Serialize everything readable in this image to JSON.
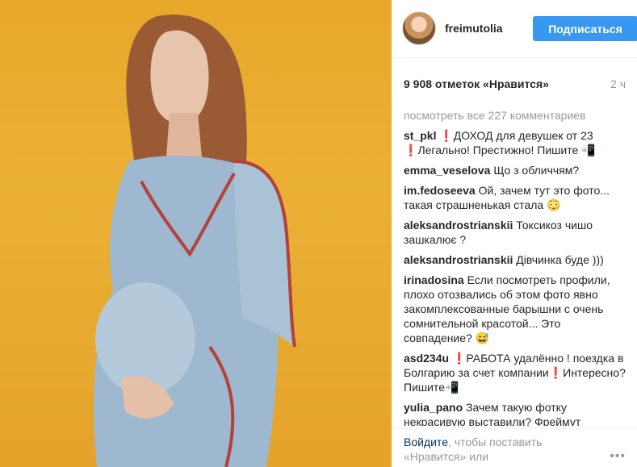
{
  "post": {
    "username": "freimutolia",
    "follow_label": "Подписаться",
    "likes_text": "9 908 отметок «Нравится»",
    "time_ago": "2 ч",
    "view_all_comments": "посмотреть все 227 комментариев",
    "comments": [
      {
        "user": "st_pkl",
        "parts": [
          {
            "t": "❗",
            "c": "excl"
          },
          {
            "t": "ДОХОД для девушек от 23 "
          },
          {
            "t": "❗",
            "c": "excl"
          },
          {
            "t": "Легально! Престижно! Пишите 📲"
          }
        ]
      },
      {
        "user": "emma_veselova",
        "parts": [
          {
            "t": "Що з обличчям?"
          }
        ]
      },
      {
        "user": "im.fedoseeva",
        "parts": [
          {
            "t": "Ой, зачем тут это фото... такая страшненькая стала 😳"
          }
        ]
      },
      {
        "user": "aleksandrostrianskii",
        "parts": [
          {
            "t": "Токсикоз чишо зашкалює ?"
          }
        ]
      },
      {
        "user": "aleksandrostrianskii",
        "parts": [
          {
            "t": "Дівчинка буде )))"
          }
        ]
      },
      {
        "user": "irinadosina",
        "parts": [
          {
            "t": "Если посмотреть профили, плохо отозвались об этом фото явно закомплексованные барышни с очень сомнительной красотой... Это совпадение? 😅"
          }
        ]
      },
      {
        "user": "asd234u",
        "parts": [
          {
            "t": "❗",
            "c": "excl"
          },
          {
            "t": "РАБОТА удалённо ! поездка в Болгарию за счет компании"
          },
          {
            "t": "❗",
            "c": "excl"
          },
          {
            "t": "Интересно? Пишите📲"
          }
        ]
      },
      {
        "user": "yulia_pano",
        "parts": [
          {
            "t": "Зачем такую фотку некрасивую выставили? Фреймут"
          }
        ]
      }
    ],
    "login_prompt_link": "Войдите",
    "login_prompt_text": ", чтобы поставить «Нравится» или",
    "more_icon": "ellipsis-icon"
  },
  "colors": {
    "follow_button": "#3897f0",
    "muted": "#999999",
    "link": "#003569",
    "photo_background": "#e8a82a"
  }
}
